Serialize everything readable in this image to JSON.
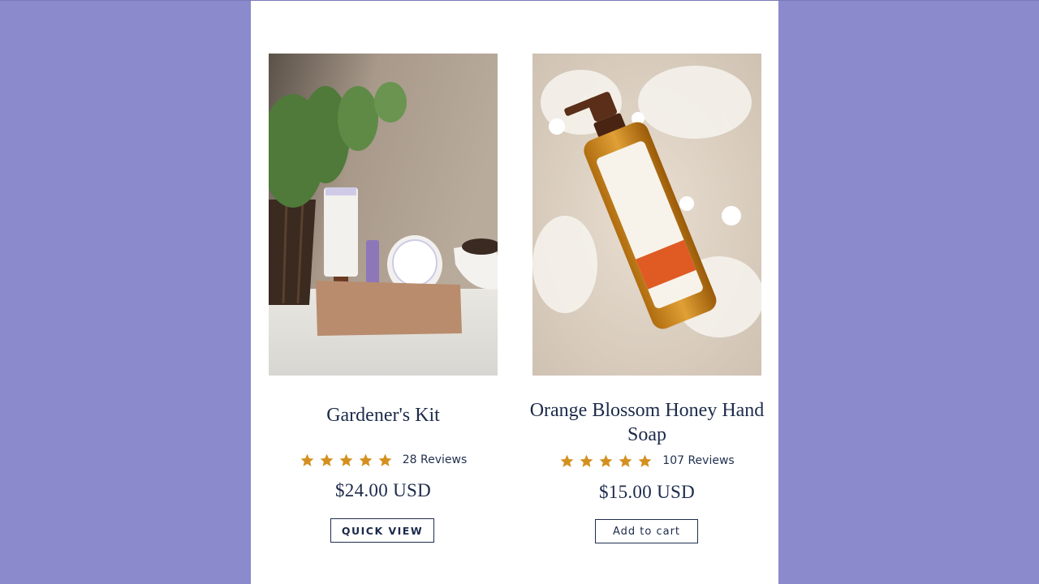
{
  "colors": {
    "backdrop": "#8a8acd",
    "text": "#1c2a4a",
    "star": "#d4901f"
  },
  "products": [
    {
      "title": "Gardener's Kit",
      "stars": 5,
      "reviews": "28 Reviews",
      "price": "$24.00 USD",
      "button": "QUICK VIEW",
      "image_icon": "gardeners-kit-photo"
    },
    {
      "title": "Orange Blossom Honey Hand Soap",
      "stars": 5,
      "reviews": "107 Reviews",
      "price": "$15.00 USD",
      "button": "Add to cart",
      "image_icon": "hand-soap-photo"
    }
  ]
}
